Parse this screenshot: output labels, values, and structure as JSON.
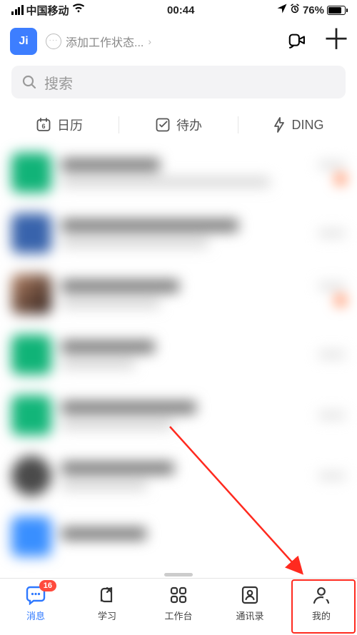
{
  "status_bar": {
    "carrier": "中国移动",
    "time": "00:44",
    "battery_pct": "76%"
  },
  "header": {
    "avatar_initials": "Ji",
    "work_status_placeholder": "添加工作状态...",
    "chevron": "›"
  },
  "search": {
    "placeholder": "搜索"
  },
  "quick": {
    "calendar": "日历",
    "calendar_day": "6",
    "todo": "待办",
    "ding": "DING"
  },
  "bottom_nav": {
    "items": [
      {
        "label": "消息",
        "badge": "16"
      },
      {
        "label": "学习"
      },
      {
        "label": "工作台"
      },
      {
        "label": "通讯录"
      },
      {
        "label": "我的"
      }
    ]
  }
}
